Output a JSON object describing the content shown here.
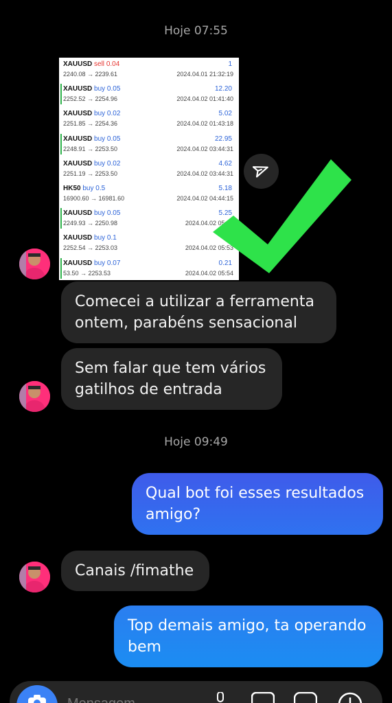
{
  "timestamps": [
    "Hoje 07:55",
    "Hoje 09:49"
  ],
  "trades": [
    {
      "symbol": "XAUUSD",
      "side": "sell",
      "lot": "0.04",
      "prices": "2240.08 → 2239.61",
      "profit": "1",
      "time": "2024.04.01 21:32:19"
    },
    {
      "symbol": "XAUUSD",
      "side": "buy",
      "lot": "0.05",
      "prices": "2252.52 → 2254.96",
      "profit": "12.20",
      "time": "2024.04.02 01:41:40"
    },
    {
      "symbol": "XAUUSD",
      "side": "buy",
      "lot": "0.02",
      "prices": "2251.85 → 2254.36",
      "profit": "5.02",
      "time": "2024.04.02 01:43:18"
    },
    {
      "symbol": "XAUUSD",
      "side": "buy",
      "lot": "0.05",
      "prices": "2248.91 → 2253.50",
      "profit": "22.95",
      "time": "2024.04.02 03:44:31"
    },
    {
      "symbol": "XAUUSD",
      "side": "buy",
      "lot": "0.02",
      "prices": "2251.19 → 2253.50",
      "profit": "4.62",
      "time": "2024.04.02 03:44:31"
    },
    {
      "symbol": "HK50",
      "side": "buy",
      "lot": "0.5",
      "prices": "16900.60 → 16981.60",
      "profit": "5.18",
      "time": "2024.04.02 04:44:15"
    },
    {
      "symbol": "XAUUSD",
      "side": "buy",
      "lot": "0.05",
      "prices": "2249.93 → 2250.98",
      "profit": "5.25",
      "time": "2024.04.02 05:43"
    },
    {
      "symbol": "XAUUSD",
      "side": "buy",
      "lot": "0.1",
      "prices": "2252.54 → 2253.03",
      "profit": "",
      "time": "2024.04.02 05:53"
    },
    {
      "symbol": "XAUUSD",
      "side": "buy",
      "lot": "0.07",
      "prices": "53.50 → 2253.53",
      "profit": "0.21",
      "time": "2024.04.02 05:54"
    }
  ],
  "messages": {
    "m1": "Comecei a utilizar a ferramenta ontem, parabéns sensacional",
    "m2": "Sem falar que tem vários gatilhos de entrada",
    "m3": "Qual bot foi esses resultados amigo?",
    "m4": "Canais /fimathe",
    "m5": "Top demais amigo, ta operando bem"
  },
  "composer": {
    "placeholder": "Mensagem..."
  },
  "colors": {
    "check": "#2ee24a",
    "outgoing": "#3f5bea",
    "incoming": "#262626"
  },
  "icons": [
    "share-icon",
    "check-icon",
    "camera-icon",
    "microphone-icon",
    "gallery-icon",
    "sticker-icon",
    "add-icon"
  ]
}
